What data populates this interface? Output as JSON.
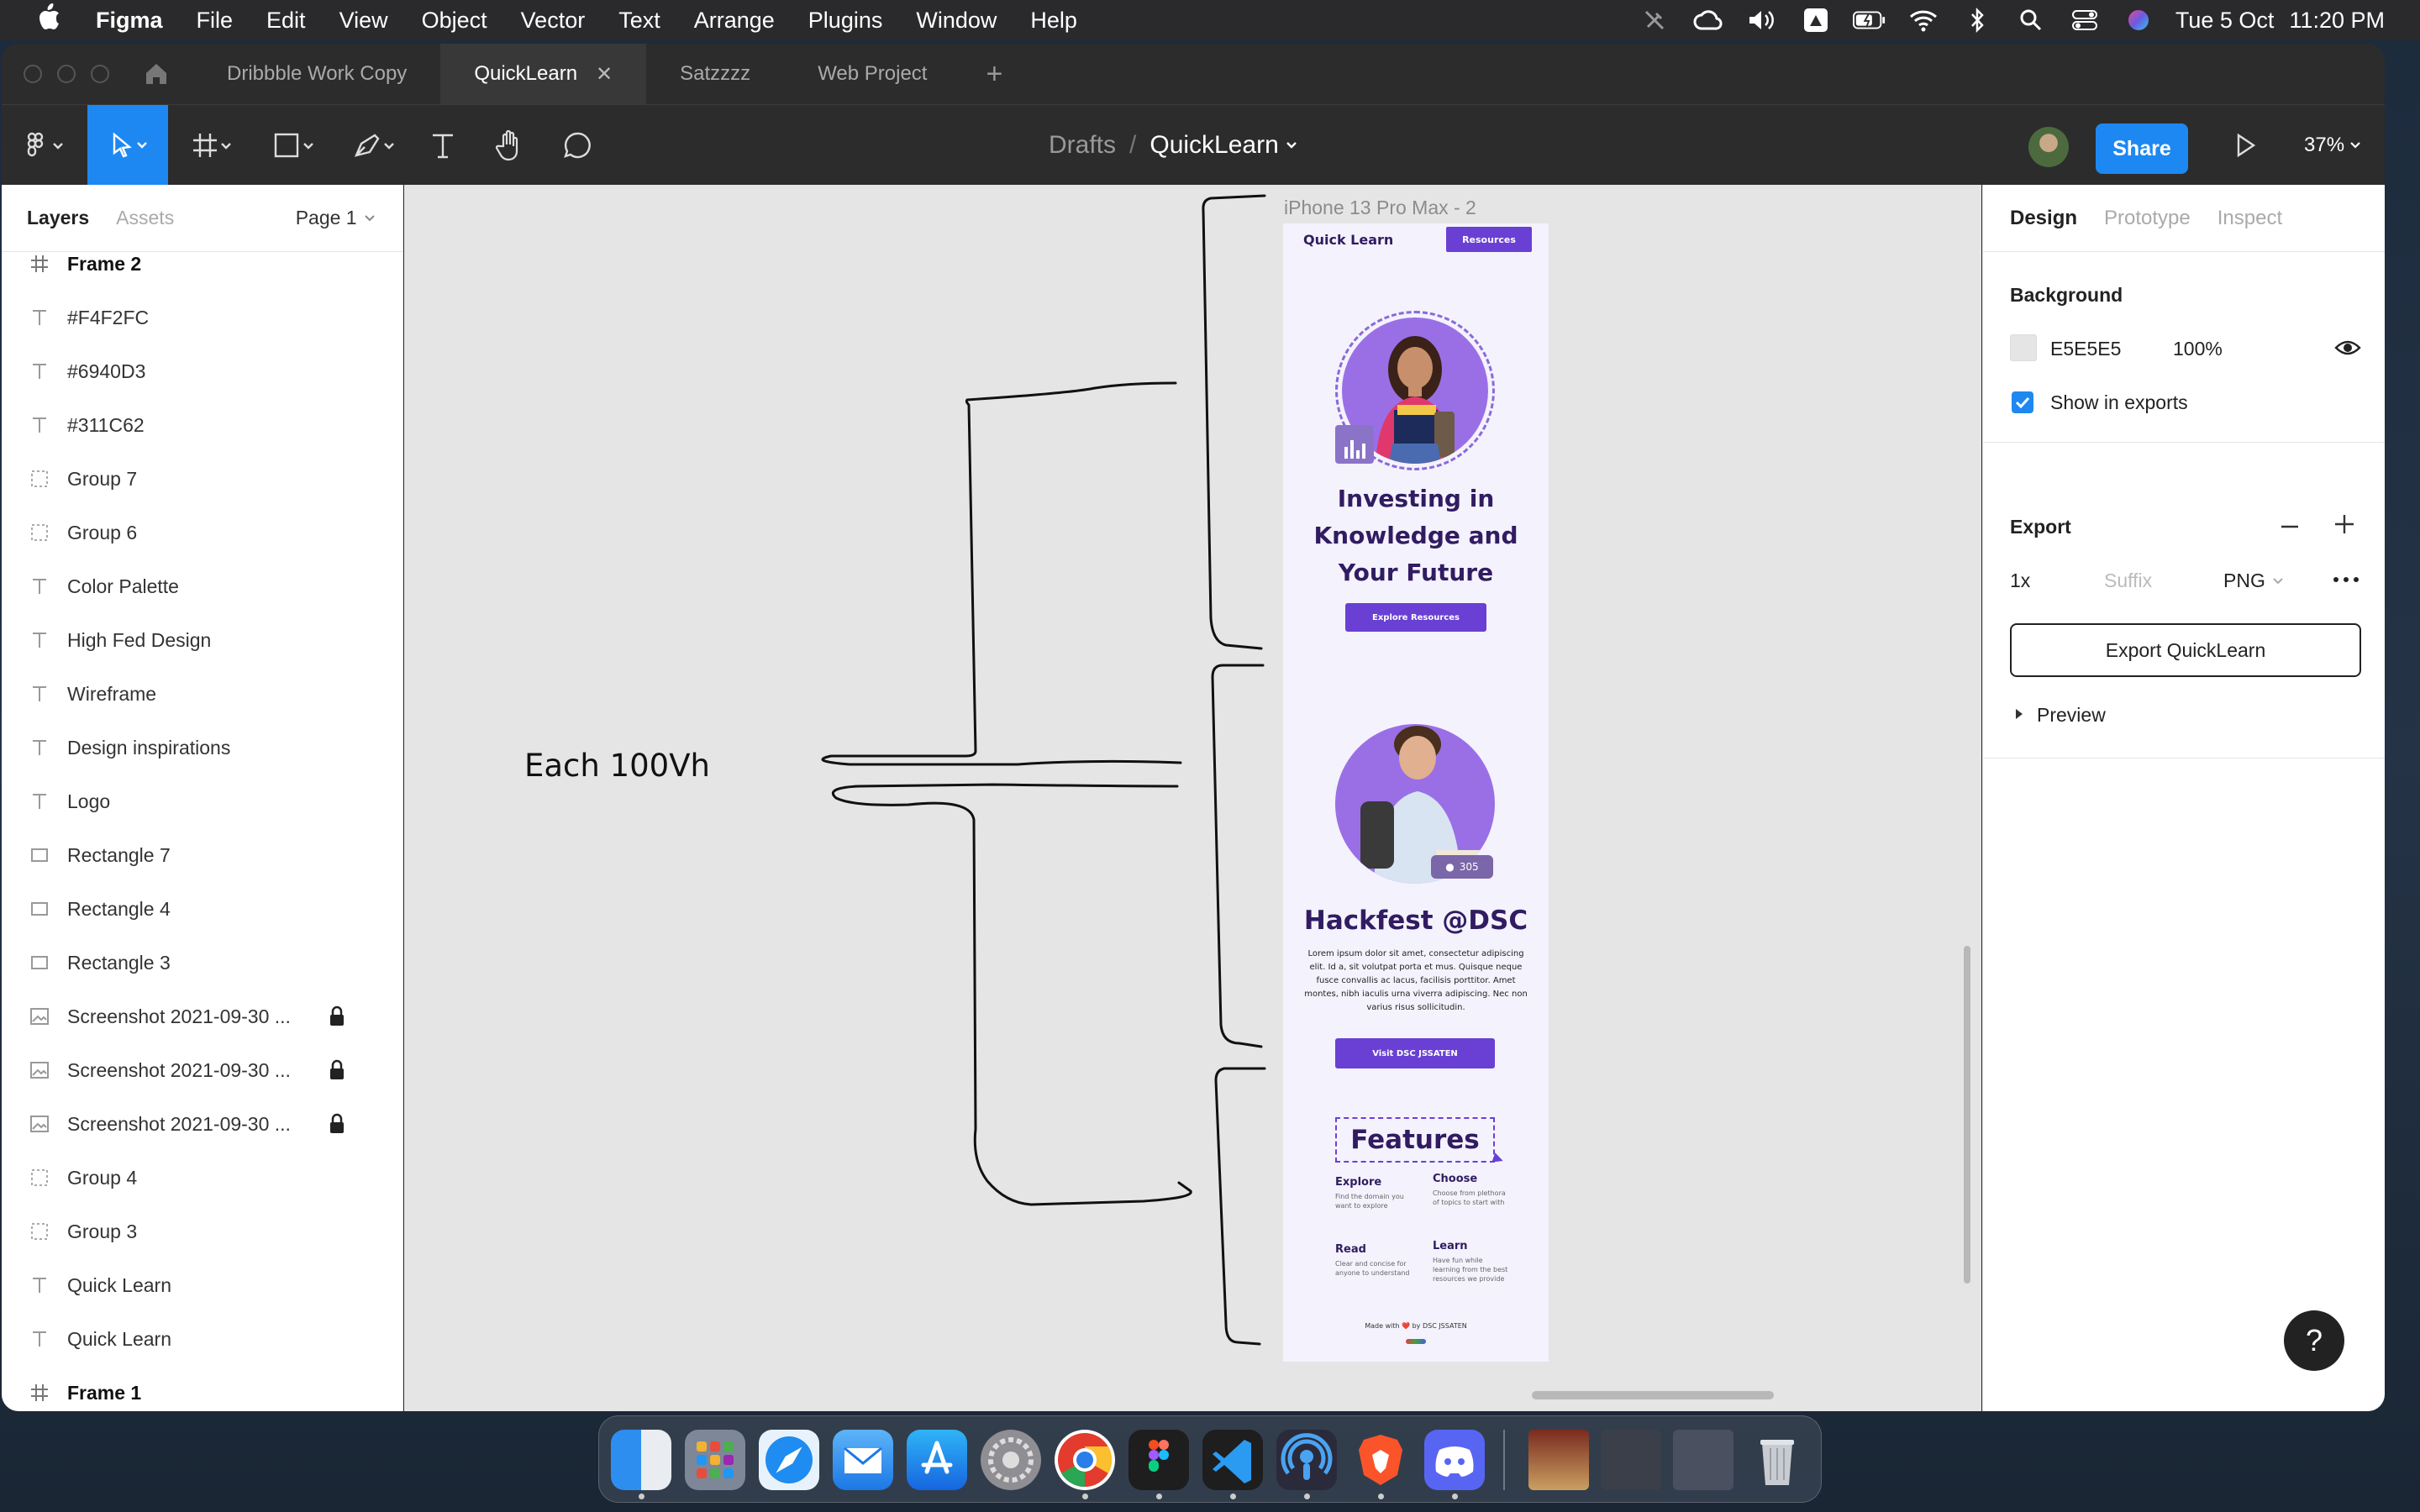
{
  "menubar": {
    "app": "Figma",
    "items": [
      "File",
      "Edit",
      "View",
      "Object",
      "Vector",
      "Text",
      "Arrange",
      "Plugins",
      "Window",
      "Help"
    ],
    "date": "Tue 5 Oct",
    "time": "11:20 PM"
  },
  "tabs": [
    {
      "label": "Dribbble Work Copy"
    },
    {
      "label": "QuickLearn",
      "active": true
    },
    {
      "label": "Satzzzz"
    },
    {
      "label": "Web Project"
    }
  ],
  "toolbar": {
    "drafts": "Drafts",
    "separator": "/",
    "project": "QuickLearn",
    "share": "Share",
    "zoom": "37%"
  },
  "left_panel": {
    "tab_layers": "Layers",
    "tab_assets": "Assets",
    "page": "Page 1",
    "layers": [
      {
        "name": "Frame 2",
        "icon": "frame-icon",
        "bold": true
      },
      {
        "name": "#F4F2FC",
        "icon": "text-icon"
      },
      {
        "name": "#6940D3",
        "icon": "text-icon"
      },
      {
        "name": "#311C62",
        "icon": "text-icon"
      },
      {
        "name": "Group 7",
        "icon": "group-icon"
      },
      {
        "name": "Group 6",
        "icon": "group-icon"
      },
      {
        "name": "Color Palette",
        "icon": "text-icon"
      },
      {
        "name": "High Fed Design",
        "icon": "text-icon"
      },
      {
        "name": "Wireframe",
        "icon": "text-icon"
      },
      {
        "name": "Design inspirations",
        "icon": "text-icon"
      },
      {
        "name": "Logo",
        "icon": "text-icon"
      },
      {
        "name": "Rectangle 7",
        "icon": "rectangle-icon"
      },
      {
        "name": "Rectangle 4",
        "icon": "rectangle-icon"
      },
      {
        "name": "Rectangle 3",
        "icon": "rectangle-icon"
      },
      {
        "name": "Screenshot 2021-09-30 ...",
        "icon": "image-icon",
        "locked": true
      },
      {
        "name": "Screenshot 2021-09-30 ...",
        "icon": "image-icon",
        "locked": true
      },
      {
        "name": "Screenshot 2021-09-30 ...",
        "icon": "image-icon",
        "locked": true
      },
      {
        "name": "Group 4",
        "icon": "group-icon"
      },
      {
        "name": "Group 3",
        "icon": "group-icon"
      },
      {
        "name": "Quick Learn",
        "icon": "text-icon"
      },
      {
        "name": "Quick Learn",
        "icon": "text-icon"
      },
      {
        "name": "Frame 1",
        "icon": "frame-icon",
        "bold": true
      }
    ]
  },
  "canvas": {
    "annotation": "Each 100Vh",
    "frame_label": "iPhone 13 Pro Max - 2",
    "background": "#E5E5E5"
  },
  "mockup": {
    "brand": "Quick Learn",
    "nav_button": "Resources",
    "hero_title_1": "Investing in",
    "hero_title_2": "Knowledge and",
    "hero_title_3": "Your Future",
    "hero_button": "Explore Resources",
    "badge_count": "305",
    "section2_title": "Hackfest @DSC",
    "section2_body": "Lorem ipsum dolor sit amet, consectetur adipiscing elit. Id a, sit volutpat porta et mus. Quisque neque fusce convallis ac lacus, facilisis porttitor. Amet montes, nibh iaculis urna viverra adipiscing. Nec non varius risus sollicitudin.",
    "section2_button": "Visit DSC JSSATEN",
    "features_title": "Features",
    "features": [
      {
        "title": "Explore",
        "desc": "Find the domain you want to explore"
      },
      {
        "title": "Choose",
        "desc": "Choose from plethora of topics to start with"
      },
      {
        "title": "Read",
        "desc": "Clear and concise for anyone to understand"
      },
      {
        "title": "Learn",
        "desc": "Have fun while learning from the best resources we provide"
      }
    ],
    "footer": "Made with ❤️ by DSC JSSATEN",
    "colors": {
      "background": "#F4F2FC",
      "primary": "#6940D3",
      "dark": "#311C62"
    }
  },
  "right_panel": {
    "tab_design": "Design",
    "tab_prototype": "Prototype",
    "tab_inspect": "Inspect",
    "background_title": "Background",
    "bg_hex": "E5E5E5",
    "bg_opacity": "100%",
    "show_exports": "Show in exports",
    "export_title": "Export",
    "export_scale": "1x",
    "suffix_placeholder": "Suffix",
    "format": "PNG",
    "export_button": "Export QuickLearn",
    "preview": "Preview"
  },
  "help": "?"
}
